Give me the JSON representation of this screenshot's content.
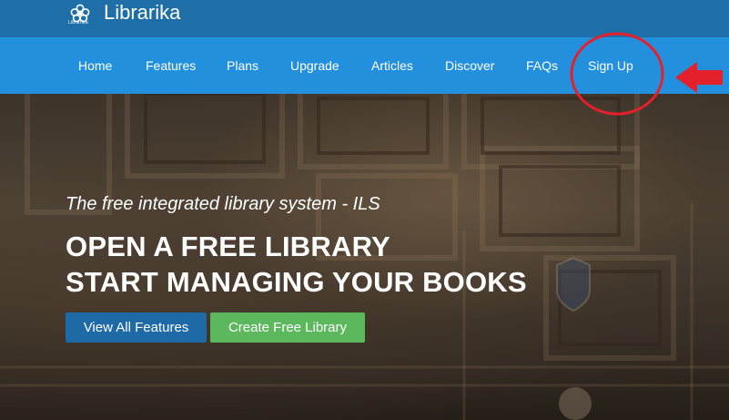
{
  "brand": {
    "name": "Librarika",
    "logo_caption": "Librarika",
    "logo_icon": "flower-logo-icon"
  },
  "nav": {
    "items": [
      {
        "label": "Home"
      },
      {
        "label": "Features"
      },
      {
        "label": "Plans"
      },
      {
        "label": "Upgrade"
      },
      {
        "label": "Articles"
      },
      {
        "label": "Discover"
      },
      {
        "label": "FAQs"
      },
      {
        "label": "Sign Up"
      }
    ]
  },
  "hero": {
    "tagline": "The free integrated library system - ILS",
    "headline_line1": "OPEN A FREE LIBRARY",
    "headline_line2": "START MANAGING YOUR BOOKS",
    "buttons": {
      "features": "View All Features",
      "create": "Create Free Library"
    }
  },
  "colors": {
    "brand_bar": "#1e6fa8",
    "nav_bar": "#2390dd",
    "primary_button": "#1d6aa6",
    "success_button": "#5cb85c",
    "annotation": "#e4202b"
  }
}
